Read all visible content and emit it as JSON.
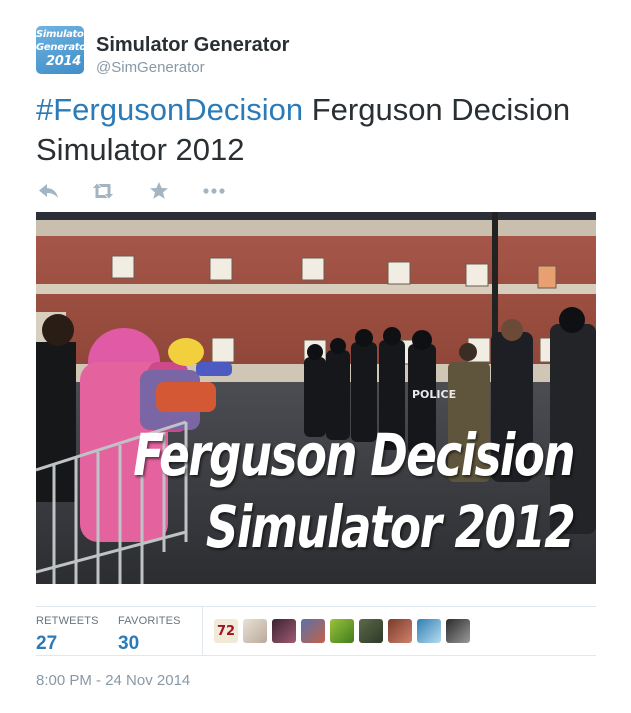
{
  "user": {
    "name": "Simulator Generator",
    "handle": "@SimGenerator",
    "avatar": {
      "line1": "Simulator",
      "line2": "Generator",
      "line3": "2014"
    }
  },
  "tweet": {
    "hashtag": "#FergusonDecision",
    "text": " Ferguson Decision Simulator 2012"
  },
  "actions": {
    "icons": [
      "reply-icon",
      "retweet-icon",
      "favorite-icon",
      "more-icon"
    ],
    "color": "#a3b4c2"
  },
  "media": {
    "overlay_line1": "Ferguson Decision",
    "overlay_line2": "Simulator 2012",
    "police_vest_text": "POLICE"
  },
  "stats": {
    "retweets_label": "RETWEETS",
    "retweets_count": "27",
    "favorites_label": "FAVORITES",
    "favorites_count": "30"
  },
  "favoriters": {
    "first_avatar_text": "72",
    "count_shown": 9
  },
  "timestamp": "8:00 PM - 24 Nov 2014",
  "colors": {
    "link": "#2b7bb9",
    "text": "#292f33",
    "muted": "#8899a6",
    "divider": "#e1e8ed"
  }
}
